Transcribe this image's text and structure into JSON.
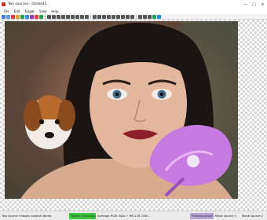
{
  "window": {
    "title": "Two sources - starbe42",
    "minimize": "—",
    "maximize": "□",
    "close": "✕"
  },
  "menu": [
    "File",
    "Edit",
    "Target",
    "View",
    "Help"
  ],
  "toolbar": {
    "icon_colors": [
      "#4a7bd0",
      "#6a9ad8",
      "#d64545",
      "#d9a13a",
      "#2d9b4f",
      "#3b8be0",
      "#8e44ad",
      "#d64545",
      "#2d9b4f",
      "#555",
      "#555",
      "#555",
      "#555",
      "#555",
      "#555",
      "#555",
      "#555",
      "#555",
      "#555",
      "#555",
      "#555",
      "#555",
      "#555",
      "#555",
      "#555",
      "#555",
      "#555",
      "#555",
      "#555",
      "#555",
      "#2d9b4f",
      "#2f8cdc"
    ]
  },
  "status": {
    "left": "Two source images loaded (done)",
    "target": "Target: Selection",
    "rgb": "average RGB: 8AA + RB 128 256 L",
    "preview": "Preview pixels",
    "mask": "Mask source 1",
    "mask2": "Mask source 2"
  },
  "colors": {
    "status_green": "#3fc23f",
    "status_purple": "#b7a3d4"
  }
}
